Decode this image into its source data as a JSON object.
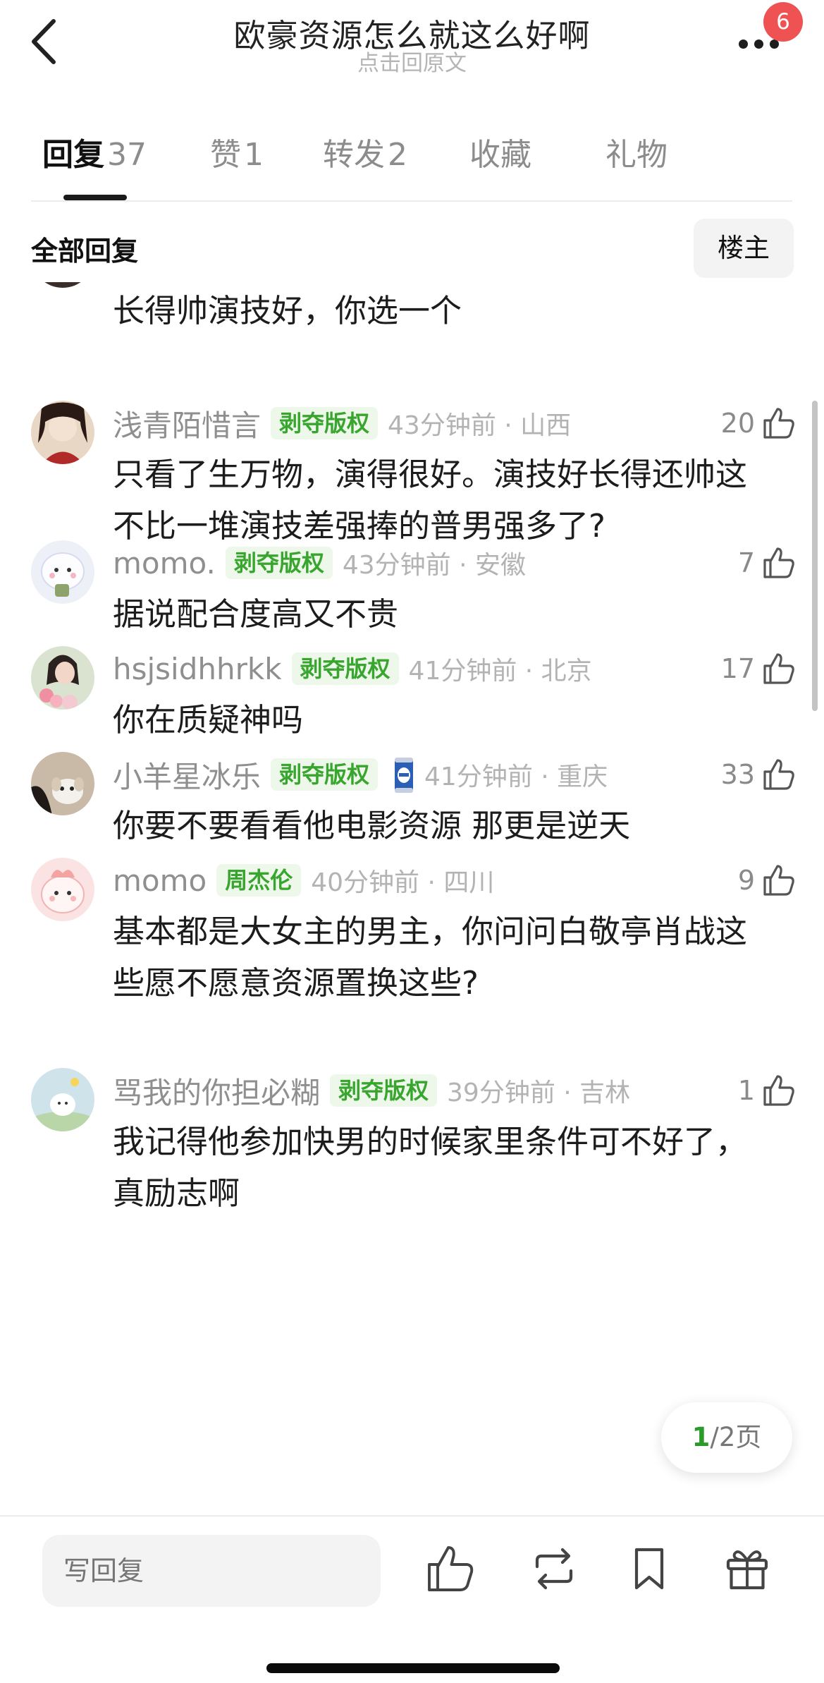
{
  "header": {
    "title": "欧豪资源怎么就这么好啊",
    "subtitle": "点击回原文",
    "notification_count": "6",
    "icons": {
      "back": "chevron-left-icon",
      "more": "more-dots-icon"
    }
  },
  "tabs": [
    {
      "label": "回复",
      "count": "37",
      "active": true
    },
    {
      "label": "赞",
      "count": "1",
      "active": false
    },
    {
      "label": "转发",
      "count": "2",
      "active": false
    },
    {
      "label": "收藏",
      "count": "",
      "active": false
    },
    {
      "label": "礼物",
      "count": "",
      "active": false
    }
  ],
  "filter": {
    "section_title": "全部回复",
    "owner_button": "楼主"
  },
  "comments": [
    {
      "username": "",
      "tag": "",
      "time": "",
      "likes": "",
      "text": "长得帅演技好，你选一个"
    },
    {
      "username": "浅青陌惜言",
      "tag": "剥夺版权",
      "time": "43分钟前 · 山西",
      "likes": "20",
      "text": "只看了生万物，演得很好。演技好长得还帅这不比一堆演技差强捧的普男强多了?"
    },
    {
      "username": "momo.",
      "tag": "剥夺版权",
      "time": "43分钟前 · 安徽",
      "likes": "7",
      "text": "据说配合度高又不贵"
    },
    {
      "username": "hsjsidhhrkk",
      "tag": "剥夺版权",
      "time": "41分钟前 · 北京",
      "likes": "17",
      "text": "你在质疑神吗"
    },
    {
      "username": "小羊星冰乐",
      "tag": "剥夺版权",
      "time": "41分钟前 · 重庆",
      "likes": "33",
      "text": "你要不要看看他电影资源 那更是逆天",
      "medal": "can-badge-icon"
    },
    {
      "username": "momo",
      "tag": "周杰伦",
      "time": "40分钟前 · 四川",
      "likes": "9",
      "text": "基本都是大女主的男主，你问问白敬亭肖战这些愿不愿意资源置换这些?"
    },
    {
      "username": "骂我的你担必糊",
      "tag": "剥夺版权",
      "time": "39分钟前 · 吉林",
      "likes": "1",
      "text": "我记得他参加快男的时候家里条件可不好了，真励志啊"
    }
  ],
  "pagination": {
    "current": "1",
    "total_text": "/2页"
  },
  "bottom_bar": {
    "reply_placeholder": "写回复",
    "icons": [
      "thumbs-up-icon",
      "repost-icon",
      "bookmark-icon",
      "gift-icon"
    ]
  },
  "colors": {
    "accent_green": "#38a52e",
    "badge_red": "#ef5252",
    "tag_bg": "#eef8ea"
  }
}
